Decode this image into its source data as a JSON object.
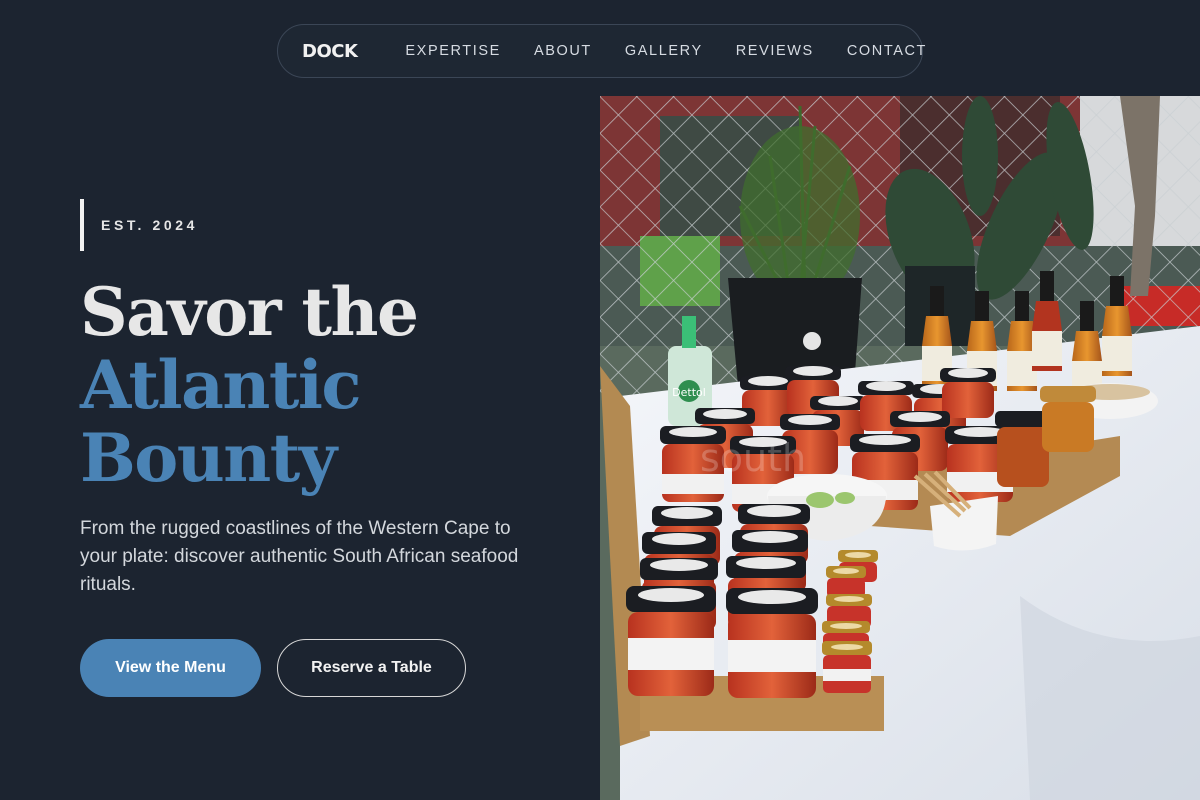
{
  "nav": {
    "brand": "DOCK",
    "links": [
      "EXPERTISE",
      "ABOUT",
      "GALLERY",
      "REVIEWS",
      "CONTACT"
    ]
  },
  "hero": {
    "eyebrow": "EST. 2024",
    "headline": {
      "line1": "Savor the",
      "line2": "Atlantic",
      "line3": "Bounty"
    },
    "description": "From the rugged coastlines of the Western Cape to your plate: discover authentic South African seafood rituals.",
    "primary_cta": "View the Menu",
    "secondary_cta": "Reserve a Table"
  },
  "photo": {
    "watermark": "south",
    "sanitizer_label": "Dettol"
  },
  "colors": {
    "background": "#1c2430",
    "accent": "#4a83b5",
    "text": "#e7e7e7"
  }
}
